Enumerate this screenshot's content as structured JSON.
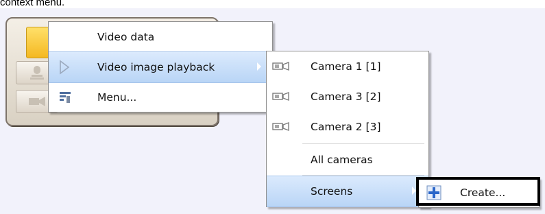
{
  "caption": "context menu.",
  "context_menu": {
    "items": [
      {
        "label": "Video data"
      },
      {
        "label": "Video image playback"
      },
      {
        "label": "Menu..."
      }
    ]
  },
  "camera_submenu": {
    "items": [
      {
        "label": "Camera 1 [1]",
        "icon": "camera-icon"
      },
      {
        "label": "Camera 3 [2]",
        "icon": "camera-icon"
      },
      {
        "label": "Camera 2 [3]",
        "icon": "camera-icon"
      },
      {
        "label": "All cameras"
      },
      {
        "label": "Screens"
      }
    ]
  },
  "screens_submenu": {
    "items": [
      {
        "label": "Create...",
        "icon": "plus-icon"
      }
    ]
  },
  "colors": {
    "highlight": "#c6ddf8",
    "panel_yellow": "#f4b821",
    "plus_blue": "#2a66c9"
  }
}
